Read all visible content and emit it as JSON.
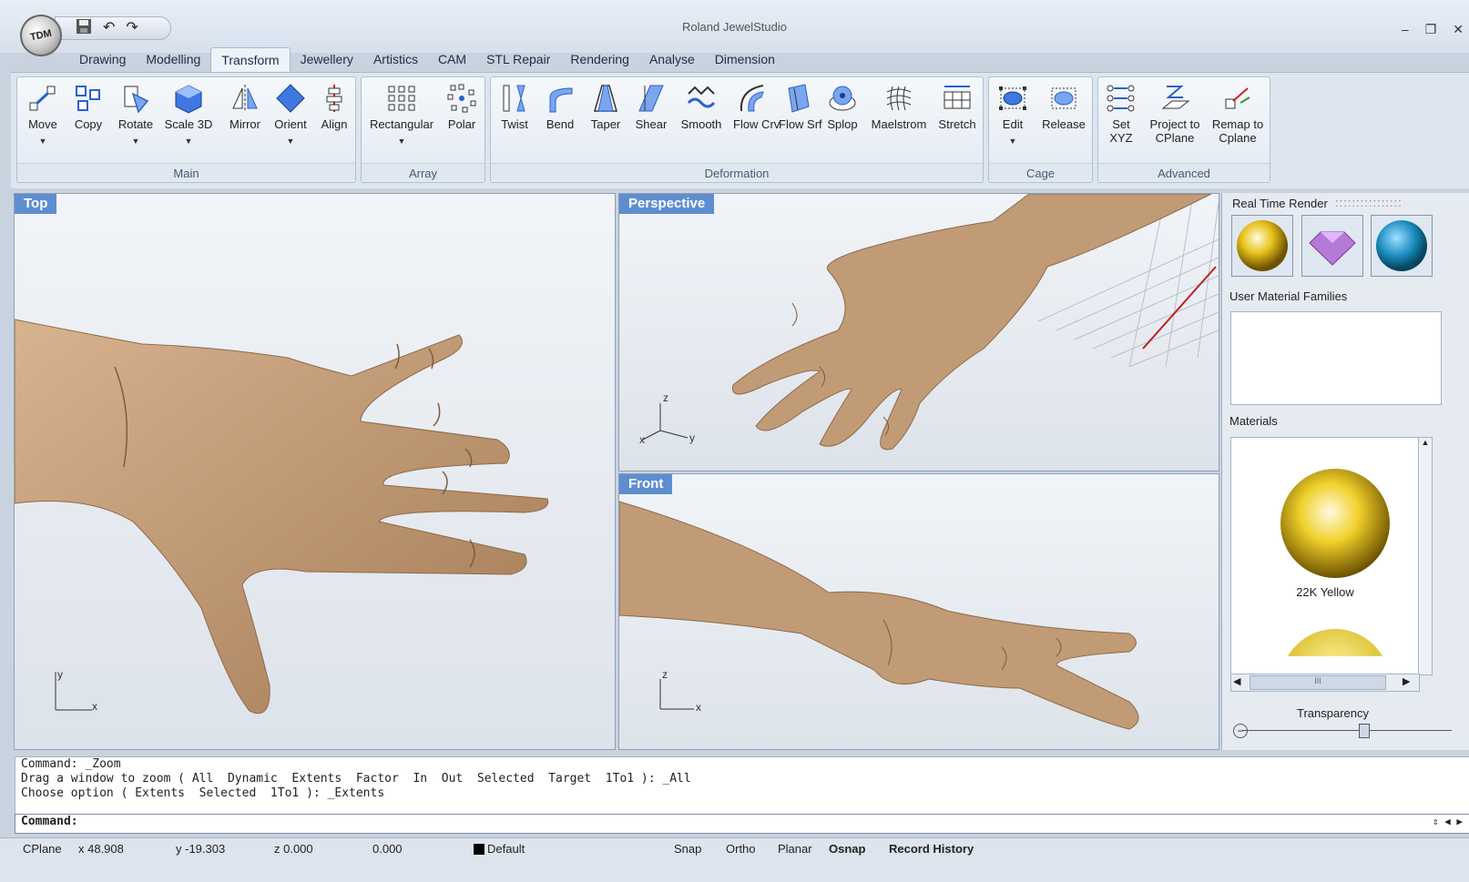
{
  "app": {
    "title": "Roland JewelStudio",
    "logo_text": "TDM"
  },
  "window_controls": {
    "minimize": "–",
    "restore": "❐",
    "close": "✕"
  },
  "tabs": [
    "Drawing",
    "Modelling",
    "Transform",
    "Jewellery",
    "Artistics",
    "CAM",
    "STL Repair",
    "Rendering",
    "Analyse",
    "Dimension"
  ],
  "active_tab": "Transform",
  "ribbon": {
    "main": {
      "label": "Main",
      "buttons": [
        "Move",
        "Copy",
        "Rotate",
        "Scale 3D",
        "Mirror",
        "Orient",
        "Align"
      ]
    },
    "array": {
      "label": "Array",
      "buttons": [
        "Rectangular",
        "Polar"
      ]
    },
    "deformation": {
      "label": "Deformation",
      "buttons": [
        "Twist",
        "Bend",
        "Taper",
        "Shear",
        "Smooth",
        "Flow Crv",
        "Flow Srf",
        "Splop",
        "Maelstrom",
        "Stretch"
      ]
    },
    "cage": {
      "label": "Cage",
      "buttons": [
        "Edit",
        "Release"
      ]
    },
    "advanced": {
      "label": "Advanced",
      "buttons": [
        "Set XYZ",
        "Project to CPlane",
        "Remap to Cplane"
      ]
    }
  },
  "viewports": {
    "top": {
      "title": "Top",
      "axes": [
        "y",
        "x"
      ]
    },
    "perspective": {
      "title": "Perspective",
      "axes": [
        "z",
        "x",
        "y"
      ]
    },
    "front": {
      "title": "Front",
      "axes": [
        "z",
        "x"
      ]
    }
  },
  "right_panel": {
    "title": "Real Time Render",
    "user_material_families": "User Material Families",
    "materials_label": "Materials",
    "material_name": "22K Yellow",
    "transparency": "Transparency",
    "scroll_grip": "III"
  },
  "command": {
    "history": [
      "Command: _Zoom",
      "Drag a window to zoom ( All  Dynamic  Extents  Factor  In  Out  Selected  Target  1To1 ): _All",
      "Choose option ( Extents  Selected  1To1 ): _Extents"
    ],
    "prompt": "Command:"
  },
  "statusbar": {
    "cplane": "CPlane",
    "x": "x 48.908",
    "y": "y -19.303",
    "z": "z 0.000",
    "d": "0.000",
    "layer": "Default",
    "snap": "Snap",
    "ortho": "Ortho",
    "planar": "Planar",
    "osnap": "Osnap",
    "record_history": "Record History"
  },
  "colors": {
    "accent": "#5e8ed0",
    "skin": "#c19a76",
    "gold": "#e8c21a"
  }
}
